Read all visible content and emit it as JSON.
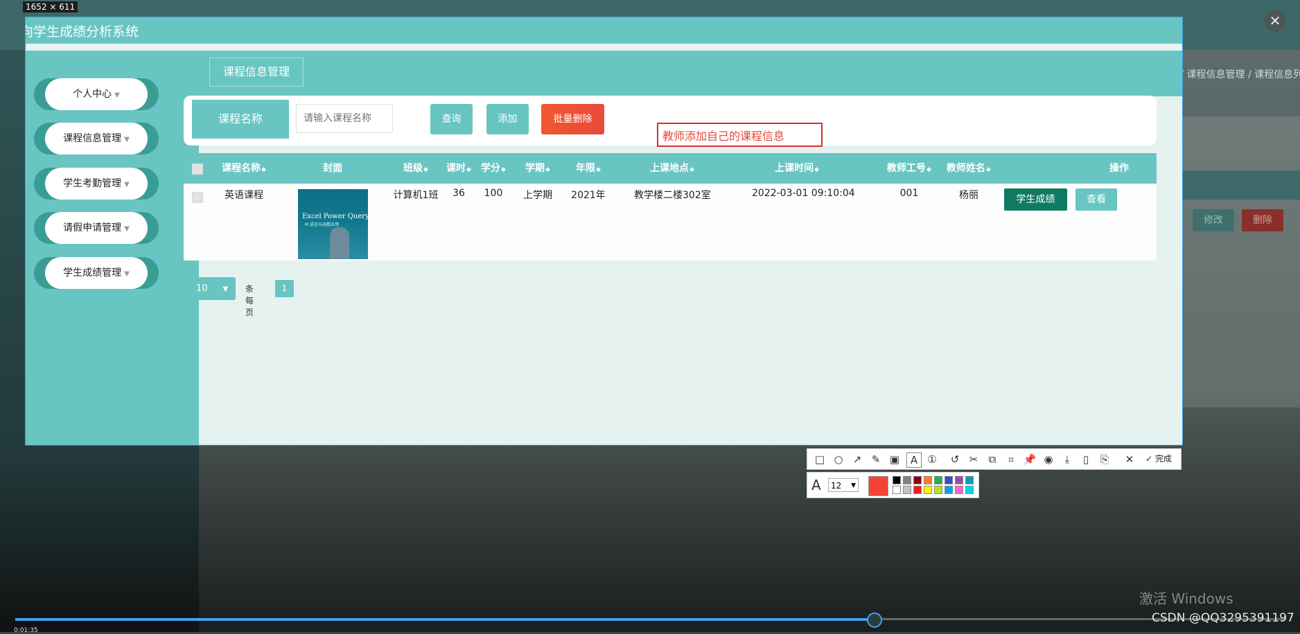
{
  "capture_size_label": "1652 × 611",
  "app": {
    "title": "面向学生成绩分析系统",
    "breadcrumb": "⌂ / 课程信息管理 / 课程信息列表",
    "sidebar": [
      {
        "label": "个人中心"
      },
      {
        "label": "课程信息管理"
      },
      {
        "label": "学生考勤管理"
      },
      {
        "label": "请假申请管理"
      },
      {
        "label": "学生成绩管理"
      }
    ],
    "page_tab": "课程信息管理",
    "search": {
      "label": "课程名称",
      "placeholder": "请输入课程名称",
      "query_button": "查询",
      "add_button": "添加",
      "batch_delete_button": "批量删除"
    },
    "annotation_text": "教师添加自己的课程信息",
    "table": {
      "columns": [
        "课程名称",
        "封面",
        "班级",
        "课时",
        "学分",
        "学期",
        "年限",
        "上课地点",
        "上课时间",
        "教师工号",
        "教师姓名",
        "操作"
      ],
      "rows": [
        {
          "course_name": "英语课程",
          "cover_title": "Excel Power Query 教程",
          "cover_subtitle": "M 语言与函数应用",
          "class": "计算机1班",
          "hours": "36",
          "credits": "100",
          "term": "上学期",
          "year": "2021年",
          "location": "教学楼二楼302室",
          "time": "2022-03-01 09:10:04",
          "teacher_id": "001",
          "teacher_name": "杨丽",
          "actions": [
            "学生成绩",
            "查看",
            "修改",
            "删除"
          ]
        }
      ]
    },
    "pagination": {
      "page_size": "10",
      "per_page_label": "条每页",
      "current_page": "1"
    }
  },
  "screenshot_toolbar": {
    "finish_label": "完成",
    "font_size": "12",
    "current_color": "#f44336",
    "palette_top": [
      "#000000",
      "#7f7f7f",
      "#880015",
      "#ff7f27",
      "#22b14c",
      "#3f48cc",
      "#a349a4",
      "#00a2b8"
    ],
    "palette_bottom": [
      "#ffffff",
      "#c3c3c3",
      "#ed1c24",
      "#fff200",
      "#b5e61d",
      "#00a2e8",
      "#ff66cc",
      "#00d9e8"
    ]
  },
  "video": {
    "time_elapsed": "0:01:35",
    "progress": 0.675
  },
  "watermarks": {
    "windows": "激活 Windows",
    "csdn": "CSDN @QQ3295391197"
  }
}
